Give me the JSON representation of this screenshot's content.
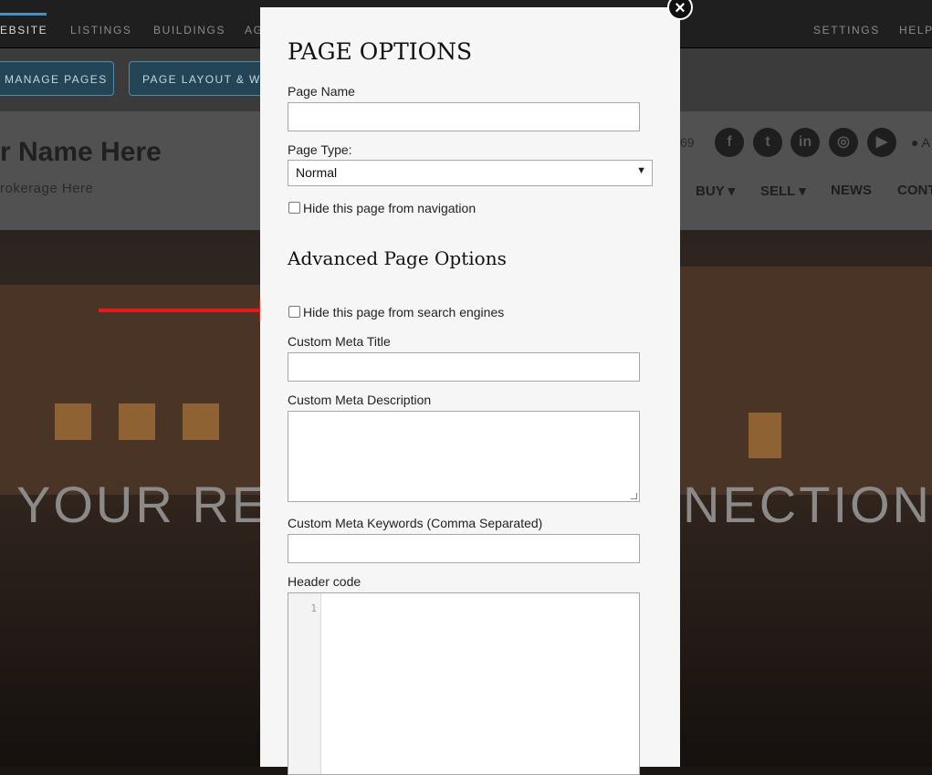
{
  "topbar": {
    "nav": [
      "EBSITE",
      "LISTINGS",
      "BUILDINGS",
      "AG"
    ],
    "right": [
      "SETTINGS",
      "HELP"
    ]
  },
  "adminbar": {
    "manage_pages": "MANAGE PAGES",
    "page_layout": "PAGE LAYOUT & WI"
  },
  "site": {
    "agent_name": "r Name Here",
    "brokerage": "rokerage Here",
    "phone_fragment": "69",
    "social_icons": [
      "facebook-icon",
      "twitter-icon",
      "linkedin-icon",
      "instagram-icon",
      "youtube-icon"
    ],
    "account_fragment": "A",
    "nav": [
      "BUY",
      "SELL",
      "NEWS",
      "CONT"
    ],
    "hero_left": "YOUR RE",
    "hero_right": "NECTION"
  },
  "modal": {
    "title": "PAGE OPTIONS",
    "close_glyph": "×",
    "page_name_label": "Page Name",
    "page_name_value": "",
    "page_type_label": "Page Type:",
    "page_type_value": "Normal",
    "hide_nav_label": "Hide this page from navigation",
    "advanced_title": "Advanced Page Options",
    "hide_search_label": "Hide this page from search engines",
    "meta_title_label": "Custom Meta Title",
    "meta_desc_label": "Custom Meta Description",
    "meta_keywords_label": "Custom Meta Keywords (Comma Separated)",
    "header_code_label": "Header code",
    "line_number": "1"
  },
  "colors": {
    "annotation_arrow": "#e41a1a",
    "admin_button": "#234556"
  }
}
